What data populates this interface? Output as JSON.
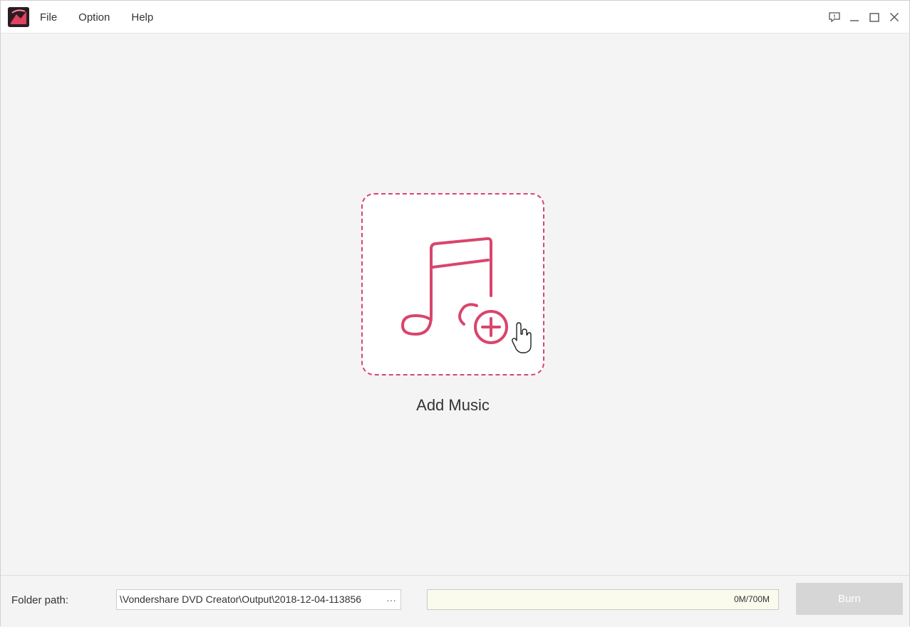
{
  "app": {
    "logo_icon": "wondershare-dvd-creator-logo"
  },
  "menu": {
    "items": [
      "File",
      "Option",
      "Help"
    ]
  },
  "window_controls": {
    "feedback_icon": "feedback-icon",
    "minimize_icon": "minimize-icon",
    "maximize_icon": "maximize-icon",
    "close_icon": "close-icon"
  },
  "main": {
    "drop_zone": {
      "icon": "music-note-add-icon",
      "cursor_icon": "hand-pointer-icon",
      "accent_color": "#d9456d"
    },
    "add_label": "Add Music"
  },
  "bottom": {
    "folder_label": "Folder path:",
    "path_value": "\\Vondershare DVD Creator\\Output\\2018-12-04-113856",
    "browse_label": "···",
    "size_text": "0M/700M",
    "size_fraction": 0,
    "burn_label": "Burn"
  }
}
